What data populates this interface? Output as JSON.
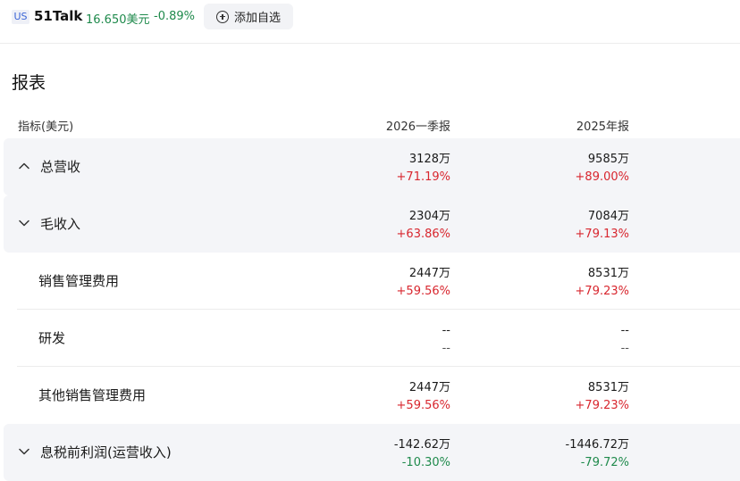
{
  "header": {
    "market": "US",
    "symbol": "51Talk",
    "price": "16.650美元",
    "change": "-0.89%",
    "watch_label": "添加自选"
  },
  "section_title": "报表",
  "columns": {
    "label": "指标(美元)",
    "col1": "2026一季报",
    "col2": "2025年报"
  },
  "rows": [
    {
      "label": "总营收",
      "icon": "chevron-up-icon",
      "c1_value": "3128万",
      "c1_pct": "+71.19%",
      "c2_value": "9585万",
      "c2_pct": "+89.00%"
    },
    {
      "label": "毛收入",
      "icon": "chevron-down-icon",
      "c1_value": "2304万",
      "c1_pct": "+63.86%",
      "c2_value": "7084万",
      "c2_pct": "+79.13%"
    },
    {
      "label": "销售管理费用",
      "c1_value": "2447万",
      "c1_pct": "+59.56%",
      "c2_value": "8531万",
      "c2_pct": "+79.23%"
    },
    {
      "label": "研发",
      "c1_value": "--",
      "c1_pct": "--",
      "c2_value": "--",
      "c2_pct": "--"
    },
    {
      "label": "其他销售管理费用",
      "c1_value": "2447万",
      "c1_pct": "+59.56%",
      "c2_value": "8531万",
      "c2_pct": "+79.23%"
    },
    {
      "label": "息税前利润(运营收入)",
      "icon": "chevron-down-icon",
      "c1_value": "-142.62万",
      "c1_pct": "-10.30%",
      "c2_value": "-1446.72万",
      "c2_pct": "-79.72%"
    }
  ],
  "colors": {
    "up": "#d8262e",
    "down": "#1f8a4c",
    "row_shade": "#f4f5f8"
  }
}
